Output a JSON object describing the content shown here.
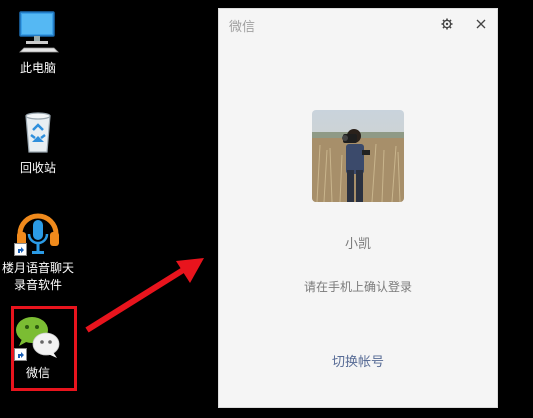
{
  "desktop": {
    "icons": [
      {
        "label": "此电脑"
      },
      {
        "label": "回收站"
      },
      {
        "label": "楼月语音聊天录音软件"
      },
      {
        "label": "微信"
      }
    ]
  },
  "wechat_window": {
    "title": "微信",
    "username": "小凯",
    "hint": "请在手机上确认登录",
    "switch_account": "切换帐号"
  },
  "colors": {
    "highlight": "#e8141d",
    "link": "#576b95",
    "wechat_green": "#7bbd33"
  },
  "icons": [
    "monitor-icon",
    "recycle-bin-icon",
    "headphones-mic-icon",
    "wechat-icon",
    "gear-icon",
    "close-icon",
    "shortcut-arrow-icon"
  ]
}
